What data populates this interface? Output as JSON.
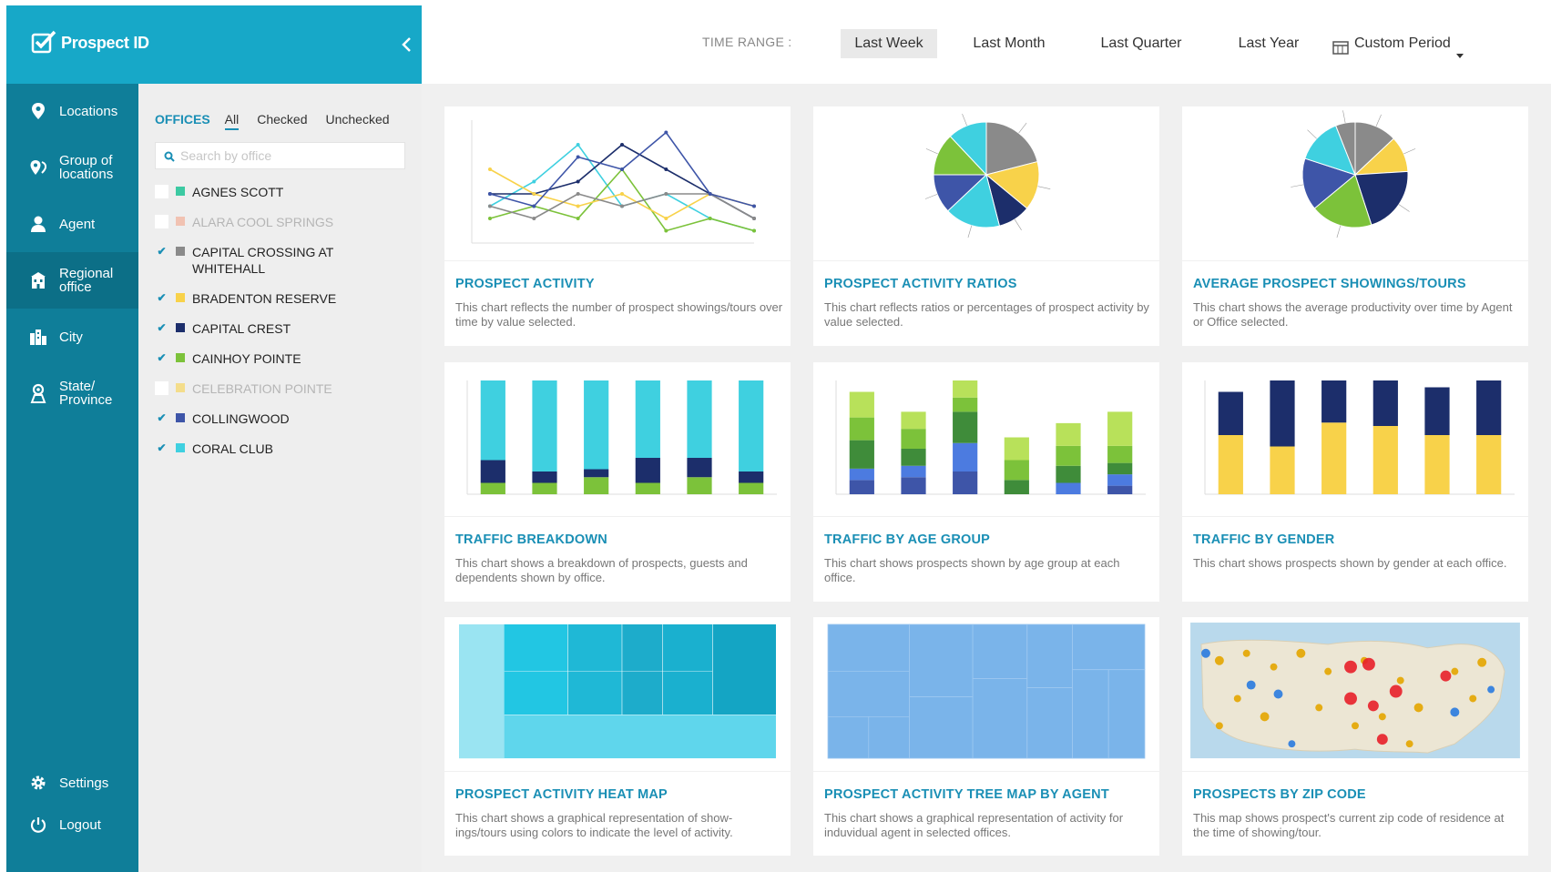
{
  "app": {
    "name": "Prospect ID"
  },
  "sidebar": {
    "items": [
      {
        "label": "Locations"
      },
      {
        "label": "Group of locations"
      },
      {
        "label": "Agent"
      },
      {
        "label": "Regional office"
      },
      {
        "label": "City"
      },
      {
        "label": "State/ Province"
      }
    ],
    "settings_label": "Settings",
    "logout_label": "Logout"
  },
  "offices": {
    "title": "OFFICES",
    "tabs": [
      "All",
      "Checked",
      "Unchecked"
    ],
    "selected_tab": "All",
    "search_placeholder": "Search by office",
    "items": [
      {
        "name": "AGNES SCOTT",
        "checked": false,
        "active": true,
        "color": "#3cc9a2"
      },
      {
        "name": "ALARA COOL SPRINGS",
        "checked": false,
        "active": false,
        "color": "#f4a58a"
      },
      {
        "name": "CAPITAL CROSSING AT WHITEHALL",
        "checked": true,
        "active": true,
        "color": "#8a8a8a"
      },
      {
        "name": "BRADENTON RESERVE",
        "checked": true,
        "active": true,
        "color": "#f8d24a"
      },
      {
        "name": "CAPITAL CREST",
        "checked": true,
        "active": true,
        "color": "#1c2e6b"
      },
      {
        "name": "CAINHOY POINTE",
        "checked": true,
        "active": true,
        "color": "#7cc23a"
      },
      {
        "name": "CELEBRATION POINTE",
        "checked": false,
        "active": false,
        "color": "#f8d24a"
      },
      {
        "name": "COLLINGWOOD",
        "checked": true,
        "active": true,
        "color": "#3e55a8"
      },
      {
        "name": "CORAL CLUB",
        "checked": true,
        "active": true,
        "color": "#3fd0e0"
      }
    ]
  },
  "timerange": {
    "label": "TIME RANGE :",
    "options": [
      "Last Week",
      "Last Month",
      "Last Quarter",
      "Last Year"
    ],
    "selected": "Last Week",
    "custom_label": "Custom Period"
  },
  "cards": [
    {
      "title": "PROSPECT ACTIVITY",
      "desc": "This chart reflects the number of prospect showings/tours over time by value selected."
    },
    {
      "title": "PROSPECT ACTIVITY RATIOS",
      "desc": "This chart reflects ratios or percentages of prospect activity by value selected."
    },
    {
      "title": "AVERAGE PROSPECT SHOWINGS/TOURS",
      "desc": "This chart shows the average productivity over time by Agent or Office selected."
    },
    {
      "title": "TRAFFIC BREAKDOWN",
      "desc": "This chart shows a breakdown of prospects, guests and dependents shown by office."
    },
    {
      "title": "TRAFFIC BY AGE GROUP",
      "desc": "This chart shows prospects shown by age group at each office."
    },
    {
      "title": "TRAFFIC BY GENDER",
      "desc": "This chart shows prospects shown by gender at each office."
    },
    {
      "title": "PROSPECT ACTIVITY HEAT MAP",
      "desc": "This chart shows a graphical representation of show-ings/tours using colors to indicate the level of activity."
    },
    {
      "title": "PROSPECT ACTIVITY TREE MAP BY AGENT",
      "desc": "This chart shows a graphical representation of activity for induvidual agent in selected offices."
    },
    {
      "title": "PROSPECTS BY ZIP CODE",
      "desc": "This map shows prospect's current zip code of residence at the time of showing/tour."
    }
  ],
  "colors": {
    "accent": "#17a8c8",
    "sidebar": "#0f7e99",
    "title": "#1a8fb5",
    "series": [
      "#3fd0e0",
      "#1c2e6b",
      "#7cc23a",
      "#f8d24a",
      "#8a8a8a",
      "#3e55a8"
    ]
  },
  "chart_data": [
    {
      "type": "line",
      "series": [
        {
          "values": [
            3,
            5,
            8,
            3,
            4,
            2,
            1
          ]
        },
        {
          "values": [
            4,
            4,
            5,
            8,
            6,
            4,
            2
          ]
        },
        {
          "values": [
            2,
            3,
            2,
            6,
            1,
            2,
            1
          ]
        },
        {
          "values": [
            6,
            4,
            3,
            4,
            2,
            4,
            3
          ]
        },
        {
          "values": [
            3,
            2,
            4,
            3,
            4,
            4,
            2
          ]
        },
        {
          "values": [
            4,
            3,
            7,
            6,
            9,
            4,
            3
          ]
        }
      ]
    },
    {
      "type": "pie",
      "values": [
        21,
        15,
        10,
        17,
        12,
        13,
        12
      ],
      "colors": [
        "#8a8a8a",
        "#f8d24a",
        "#1c2e6b",
        "#3fd0e0",
        "#3e55a8",
        "#7cc23a",
        "#3fd0e0"
      ]
    },
    {
      "type": "pie",
      "values": [
        13,
        11,
        21,
        19,
        16,
        14,
        6
      ],
      "colors": [
        "#8a8a8a",
        "#f8d24a",
        "#1c2e6b",
        "#7cc23a",
        "#3e55a8",
        "#3fd0e0",
        "#8a8a8a"
      ]
    },
    {
      "type": "bar",
      "series": [
        {
          "values": [
            10,
            10,
            15,
            10,
            15,
            10
          ]
        },
        {
          "values": [
            20,
            10,
            7,
            22,
            17,
            10
          ]
        },
        {
          "values": [
            70,
            80,
            78,
            68,
            68,
            80
          ]
        }
      ]
    },
    {
      "type": "bar",
      "series": [
        {
          "values": [
            5,
            6,
            8,
            0,
            0,
            3
          ]
        },
        {
          "values": [
            4,
            4,
            10,
            0,
            4,
            4
          ]
        },
        {
          "values": [
            10,
            6,
            11,
            5,
            6,
            4
          ]
        },
        {
          "values": [
            8,
            7,
            5,
            7,
            7,
            6
          ]
        },
        {
          "values": [
            9,
            6,
            6,
            8,
            8,
            12
          ]
        }
      ],
      "ylim": [
        0,
        40
      ]
    },
    {
      "type": "bar",
      "series": [
        {
          "values": [
            52,
            42,
            63,
            60,
            52,
            52
          ]
        },
        {
          "values": [
            38,
            58,
            37,
            40,
            42,
            48
          ]
        }
      ],
      "ylim": [
        0,
        100
      ]
    }
  ]
}
